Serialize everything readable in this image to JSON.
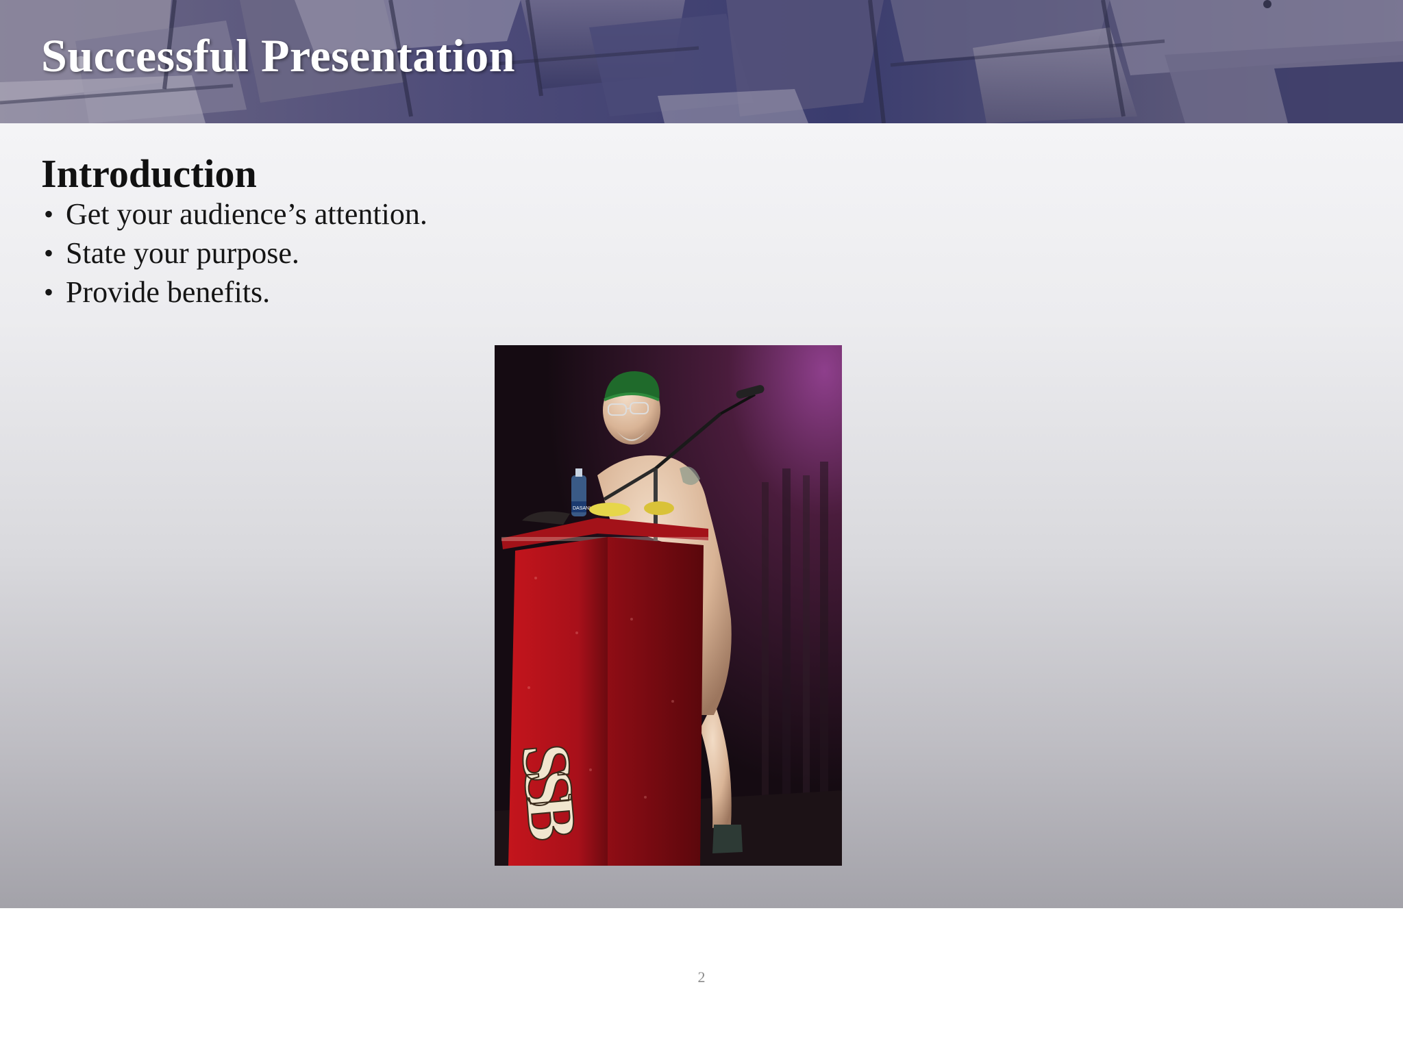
{
  "header": {
    "title": "Successful Presentation"
  },
  "section": {
    "title": "Introduction",
    "bullets": [
      "Get your audience’s attention.",
      "State your purpose.",
      "Provide benefits."
    ]
  },
  "photo": {
    "podium_lettering": "SSB",
    "bottle_label": "DASANI"
  },
  "footer": {
    "page_number": "2"
  },
  "colors": {
    "header_banner": "#4c4a78",
    "title_text": "#ffffff",
    "body_text": "#151515",
    "podium_red": "#b3141c"
  }
}
